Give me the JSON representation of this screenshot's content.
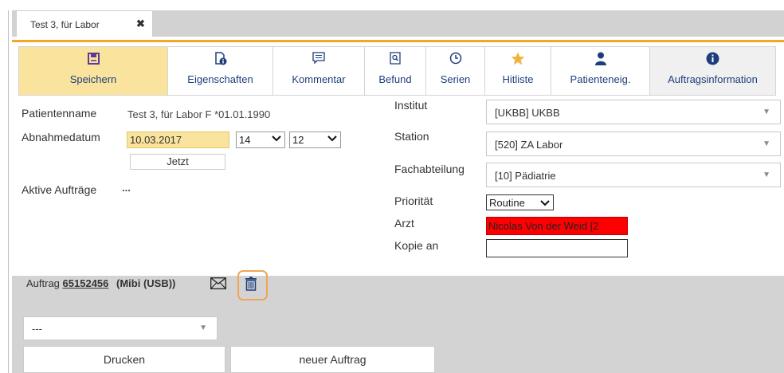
{
  "tab": {
    "title": "Test 3, für Labor",
    "close_glyph": "✖"
  },
  "toolbar": {
    "items": [
      {
        "label": "Speichern",
        "icon": "save-icon"
      },
      {
        "label": "Eigenschaften",
        "icon": "properties-icon"
      },
      {
        "label": "Kommentar",
        "icon": "comment-icon"
      },
      {
        "label": "Befund",
        "icon": "report-icon"
      },
      {
        "label": "Serien",
        "icon": "clock-icon"
      },
      {
        "label": "Hitliste",
        "icon": "star-icon"
      },
      {
        "label": "Patienteneig.",
        "icon": "person-icon"
      },
      {
        "label": "Auftragsinformation",
        "icon": "info-icon"
      }
    ]
  },
  "patient": {
    "name_label": "Patientenname",
    "name_value": "Test 3, für Labor F *01.01.1990",
    "date_label": "Abnahmedatum",
    "date_value": "10.03.2017",
    "hour_value": "14",
    "minute_value": "12",
    "now_button": "Jetzt",
    "active_orders_label": "Aktive Aufträge",
    "active_orders_value": "..."
  },
  "form": {
    "institut_label": "Institut",
    "institut_value": "[UKBB] UKBB",
    "station_label": "Station",
    "station_value": "[520] ZA Labor",
    "fach_label": "Fachabteilung",
    "fach_value": "[10] Pädiatrie",
    "prio_label": "Priorität",
    "prio_value": "Routine",
    "arzt_label": "Arzt",
    "arzt_value": "Nicolas Von der Weid  [2",
    "kopie_label": "Kopie an",
    "kopie_value": ""
  },
  "order": {
    "prefix": "Auftrag",
    "number": "65152456",
    "type": "(Mibi (USB))",
    "select_value": "---",
    "print_button": "Drucken",
    "new_button": "neuer Auftrag"
  },
  "colors": {
    "accent": "#f5a623",
    "save_bg": "#fae39c",
    "link_blue": "#1d3e7c",
    "alert_red": "#ff0000",
    "panel_gray": "#d3d3d3"
  }
}
